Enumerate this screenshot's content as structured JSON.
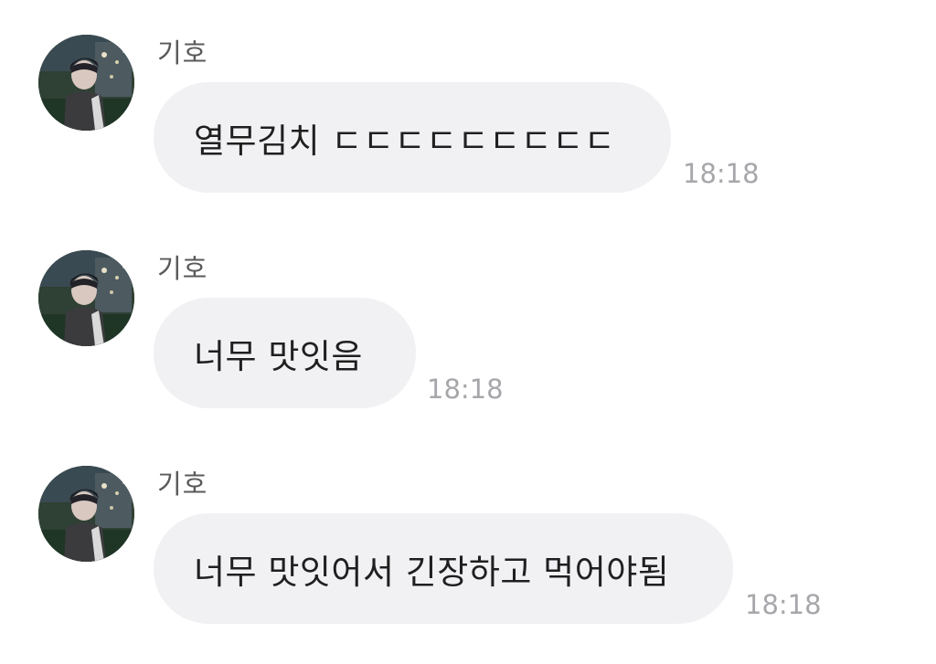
{
  "messages": [
    {
      "sender": "기호",
      "text": "열무김치 ㄷㄷㄷㄷㄷㄷㄷㄷㄷ",
      "time": "18:18",
      "avatar_icon": "profile-photo"
    },
    {
      "sender": "기호",
      "text": "너무 맛잇음",
      "time": "18:18",
      "avatar_icon": "profile-photo"
    },
    {
      "sender": "기호",
      "text": "너무 맛잇어서 긴장하고 먹어야됨",
      "time": "18:18",
      "avatar_icon": "profile-photo"
    }
  ],
  "colors": {
    "background": "#ffffff",
    "bubble": "#f1f1f4",
    "message_text": "#1f1f1f",
    "sender_text": "#595959",
    "time_text": "#a7a7ab"
  }
}
